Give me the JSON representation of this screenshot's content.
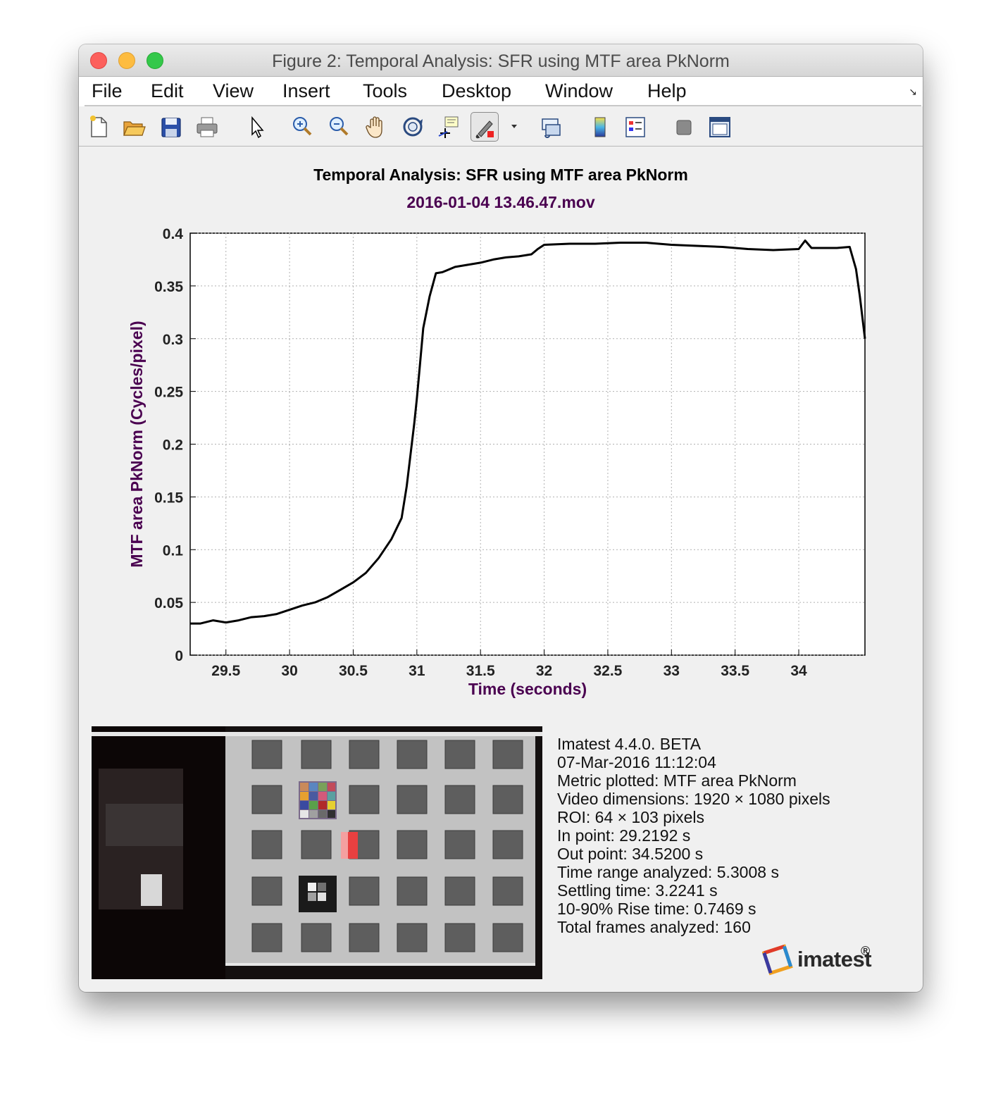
{
  "window": {
    "title": "Figure 2: Temporal Analysis: SFR using MTF area PkNorm"
  },
  "menu": {
    "items": [
      "File",
      "Edit",
      "View",
      "Insert",
      "Tools",
      "Desktop",
      "Window",
      "Help"
    ]
  },
  "toolbar": {
    "buttons": [
      {
        "name": "new-figure",
        "icon": "new-file-icon"
      },
      {
        "name": "open-file",
        "icon": "folder-open-icon"
      },
      {
        "name": "save-figure",
        "icon": "floppy-disk-icon"
      },
      {
        "name": "print-figure",
        "icon": "printer-icon"
      },
      {
        "name": "edit-plot",
        "icon": "pointer-arrow-icon"
      },
      {
        "name": "zoom-in",
        "icon": "zoom-in-icon"
      },
      {
        "name": "zoom-out",
        "icon": "zoom-out-icon"
      },
      {
        "name": "pan",
        "icon": "hand-icon"
      },
      {
        "name": "rotate-3d",
        "icon": "rotate-3d-icon"
      },
      {
        "name": "data-cursor",
        "icon": "data-cursor-icon"
      },
      {
        "name": "brush",
        "icon": "brush-icon"
      },
      {
        "name": "link-plot",
        "icon": "link-plot-icon"
      },
      {
        "name": "insert-colorbar",
        "icon": "colorbar-icon"
      },
      {
        "name": "insert-legend",
        "icon": "legend-icon"
      },
      {
        "name": "hide-plot-tools",
        "icon": "hide-tools-icon"
      },
      {
        "name": "show-plot-tools",
        "icon": "show-tools-icon"
      }
    ]
  },
  "chart_data": {
    "type": "line",
    "title": "Temporal Analysis: SFR using MTF area PkNorm",
    "subtitle": "2016-01-04 13.46.47.mov",
    "xlabel": "Time (seconds)",
    "ylabel": "MTF area PkNorm (Cycles/pixel)",
    "xlim": [
      29.2192,
      34.52
    ],
    "ylim": [
      0,
      0.4
    ],
    "xticks": [
      "29.5",
      "30",
      "30.5",
      "31",
      "31.5",
      "32",
      "32.5",
      "33",
      "33.5",
      "34"
    ],
    "yticks": [
      "0",
      "0.05",
      "0.1",
      "0.15",
      "0.2",
      "0.25",
      "0.3",
      "0.35",
      "0.4"
    ],
    "grid": true,
    "colors": {
      "line": "#000000",
      "label": "#4a0050",
      "title": "#000000"
    },
    "series": [
      {
        "x": [
          29.2192,
          29.3,
          29.4,
          29.5,
          29.6,
          29.7,
          29.8,
          29.9,
          30.0,
          30.1,
          30.2,
          30.3,
          30.4,
          30.5,
          30.6,
          30.7,
          30.8,
          30.88,
          30.92,
          30.95,
          30.98,
          31.0,
          31.02,
          31.05,
          31.1,
          31.15,
          31.2,
          31.3,
          31.4,
          31.5,
          31.6,
          31.7,
          31.8,
          31.9,
          31.95,
          32.0,
          32.2,
          32.4,
          32.6,
          32.8,
          33.0,
          33.2,
          33.4,
          33.6,
          33.8,
          34.0,
          34.05,
          34.1,
          34.2,
          34.3,
          34.4,
          34.45,
          34.48,
          34.52
        ],
        "y": [
          0.03,
          0.03,
          0.033,
          0.031,
          0.033,
          0.036,
          0.037,
          0.039,
          0.043,
          0.047,
          0.05,
          0.055,
          0.062,
          0.069,
          0.078,
          0.092,
          0.11,
          0.13,
          0.16,
          0.19,
          0.22,
          0.243,
          0.27,
          0.31,
          0.34,
          0.362,
          0.363,
          0.368,
          0.37,
          0.372,
          0.375,
          0.377,
          0.378,
          0.38,
          0.385,
          0.389,
          0.39,
          0.39,
          0.391,
          0.391,
          0.389,
          0.388,
          0.387,
          0.385,
          0.384,
          0.385,
          0.393,
          0.386,
          0.386,
          0.386,
          0.387,
          0.366,
          0.34,
          0.3
        ]
      }
    ]
  },
  "info": {
    "lines": [
      "Imatest 4.4.0. BETA",
      "07-Mar-2016 11:12:04",
      "Metric plotted: MTF area PkNorm",
      "Video dimensions: 1920 × 1080 pixels",
      "ROI: 64 × 103 pixels",
      "In point: 29.2192 s",
      "Out point: 34.5200 s",
      "Time range analyzed: 5.3008 s",
      "Settling time: 3.2241 s",
      "10-90% Rise time: 0.7469 s",
      "Total frames analyzed: 160"
    ]
  },
  "logo": {
    "text": "imatest",
    "mark": "®"
  }
}
